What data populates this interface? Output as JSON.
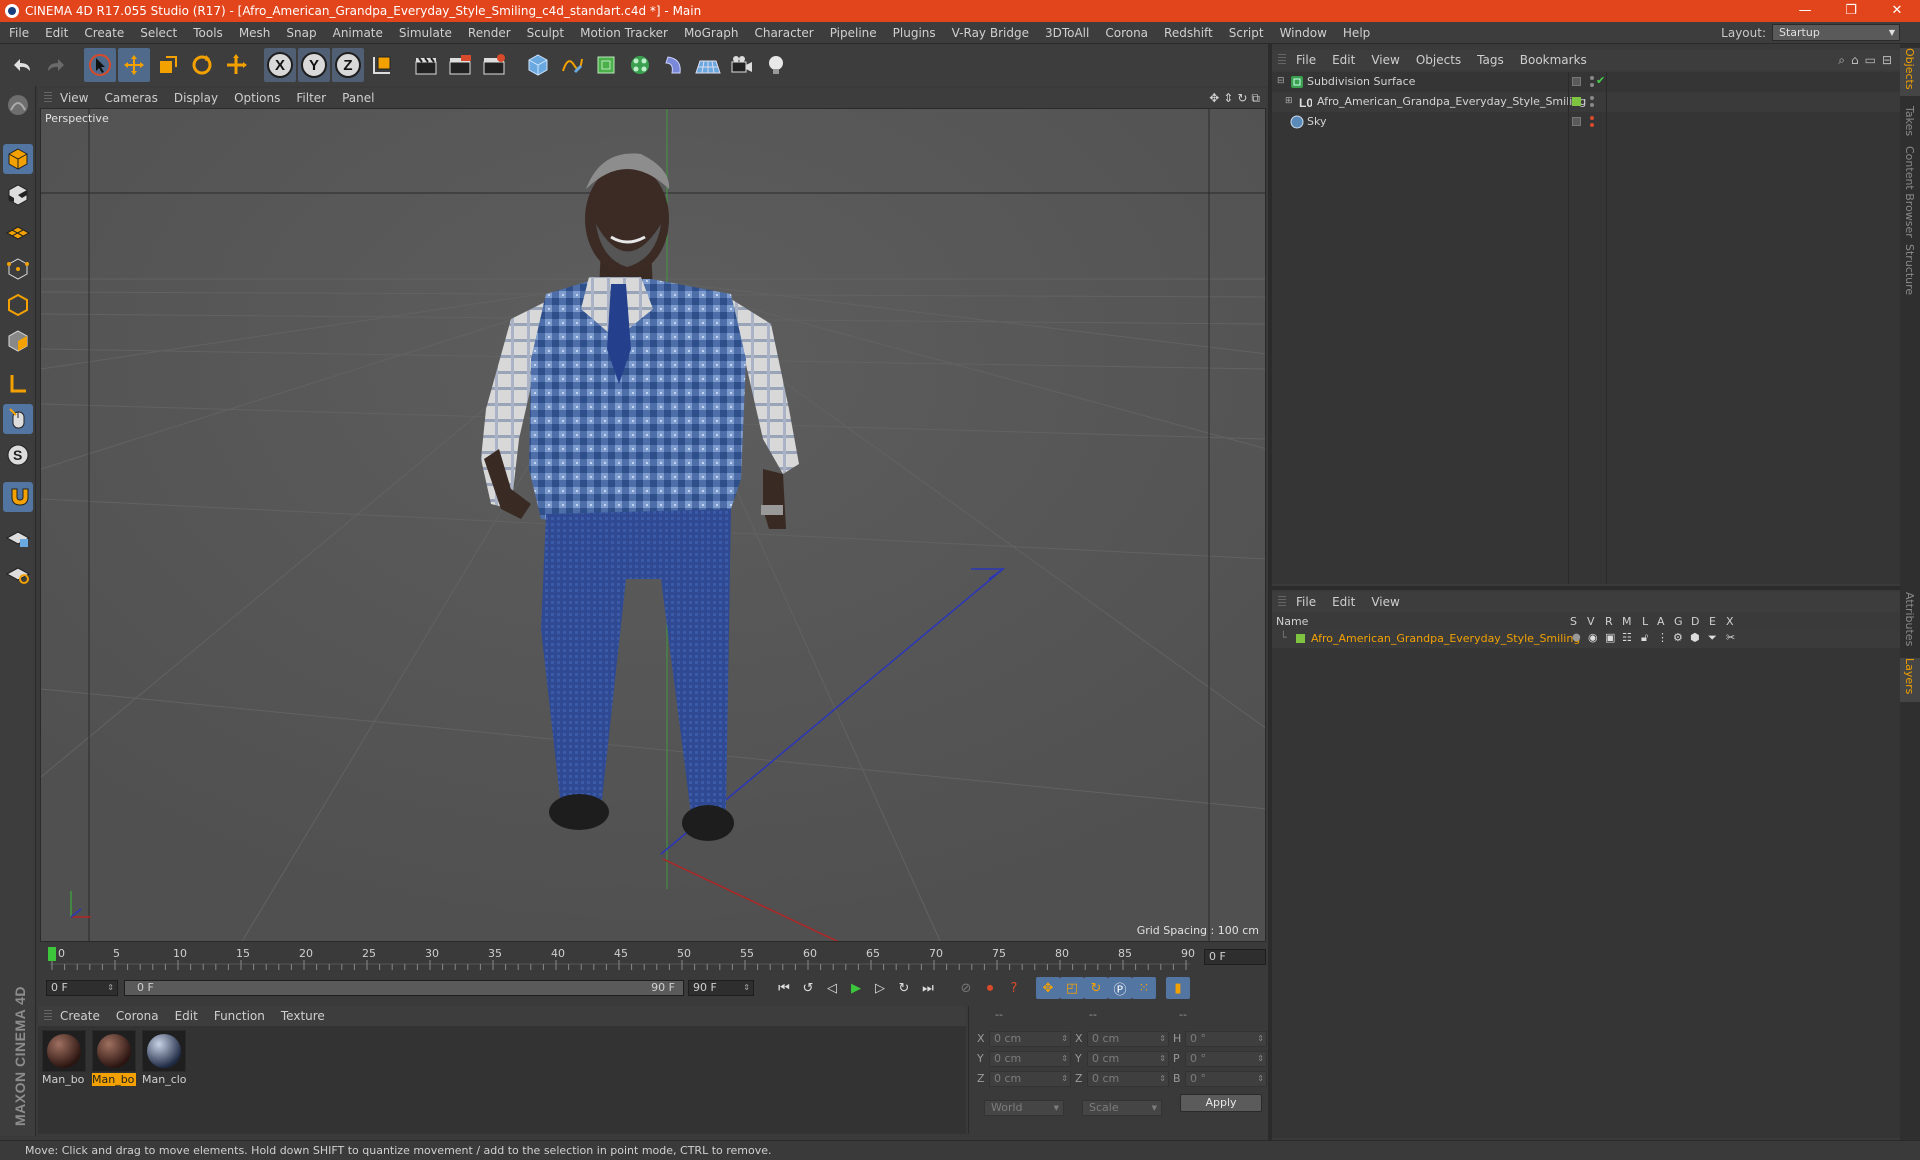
{
  "window": {
    "title": "CINEMA 4D R17.055 Studio (R17) - [Afro_American_Grandpa_Everyday_Style_Smiling_c4d_standart.c4d *] - Main",
    "controls": [
      "—",
      "❐",
      "✕"
    ]
  },
  "menubar": {
    "items": [
      "File",
      "Edit",
      "Create",
      "Select",
      "Tools",
      "Mesh",
      "Snap",
      "Animate",
      "Simulate",
      "Render",
      "Sculpt",
      "Motion Tracker",
      "MoGraph",
      "Character",
      "Pipeline",
      "Plugins",
      "V-Ray Bridge",
      "3DToAll",
      "Corona",
      "Redshift",
      "Script",
      "Window",
      "Help"
    ],
    "layout_label": "Layout:",
    "layout_value": "Startup"
  },
  "toolbar": {
    "axis_x": "X",
    "axis_y": "Y",
    "axis_z": "Z"
  },
  "viewport": {
    "menu": [
      "View",
      "Cameras",
      "Display",
      "Options",
      "Filter",
      "Panel"
    ],
    "label": "Perspective",
    "grid_spacing": "Grid Spacing : 100 cm"
  },
  "timeline": {
    "ticks": [
      "0",
      "5",
      "10",
      "15",
      "20",
      "25",
      "30",
      "35",
      "40",
      "45",
      "50",
      "55",
      "60",
      "65",
      "70",
      "75",
      "80",
      "85",
      "90"
    ],
    "current_frame": "0 F",
    "start_field": "0 F",
    "range_start": "0 F",
    "range_end": "90 F",
    "end_field": "90 F"
  },
  "materials": {
    "menu": [
      "Create",
      "Corona",
      "Edit",
      "Function",
      "Texture"
    ],
    "items": [
      {
        "label": "Man_bo",
        "selected": false
      },
      {
        "label": "Man_bo",
        "selected": true
      },
      {
        "label": "Man_clo",
        "selected": false
      }
    ]
  },
  "coordinates": {
    "headers": [
      "--",
      "--",
      "--"
    ],
    "rows": [
      {
        "a1": "X",
        "v1": "0 cm",
        "a2": "X",
        "v2": "0 cm",
        "a3": "H",
        "v3": "0 °"
      },
      {
        "a1": "Y",
        "v1": "0 cm",
        "a2": "Y",
        "v2": "0 cm",
        "a3": "P",
        "v3": "0 °"
      },
      {
        "a1": "Z",
        "v1": "0 cm",
        "a2": "Z",
        "v2": "0 cm",
        "a3": "B",
        "v3": "0 °"
      }
    ],
    "mode": "World",
    "scale": "Scale",
    "apply_label": "Apply"
  },
  "objects": {
    "menu": [
      "File",
      "Edit",
      "View",
      "Objects",
      "Tags",
      "Bookmarks"
    ],
    "items": [
      {
        "name": "Subdivision Surface",
        "color": "#4a9f3a"
      },
      {
        "name": "Afro_American_Grandpa_Everyday_Style_Smiling",
        "color": "#7ec440"
      },
      {
        "name": "Sky",
        "color": "#5a8ab8"
      }
    ]
  },
  "layers": {
    "menu": [
      "File",
      "Edit",
      "View"
    ],
    "columns": {
      "name": "Name",
      "s": "S",
      "v": "V",
      "r": "R",
      "m": "M",
      "l": "L",
      "a": "A",
      "g": "G",
      "d": "D",
      "e": "E",
      "x": "X"
    },
    "items": [
      {
        "name": "Afro_American_Grandpa_Everyday_Style_Smiling",
        "color": "#7ec440"
      }
    ]
  },
  "side_tabs": [
    "Objects",
    "Takes",
    "Content Browser",
    "Structure",
    "Attributes",
    "Layers"
  ],
  "status": {
    "text": "Move: Click and drag to move elements. Hold down SHIFT to quantize movement / add to the selection in point mode, CTRL to remove."
  },
  "branding": {
    "text": "MAXON CINEMA 4D"
  },
  "colors": {
    "title_bar": "#e2451c",
    "accent": "#f2a100",
    "active_tool": "#5275a2"
  }
}
